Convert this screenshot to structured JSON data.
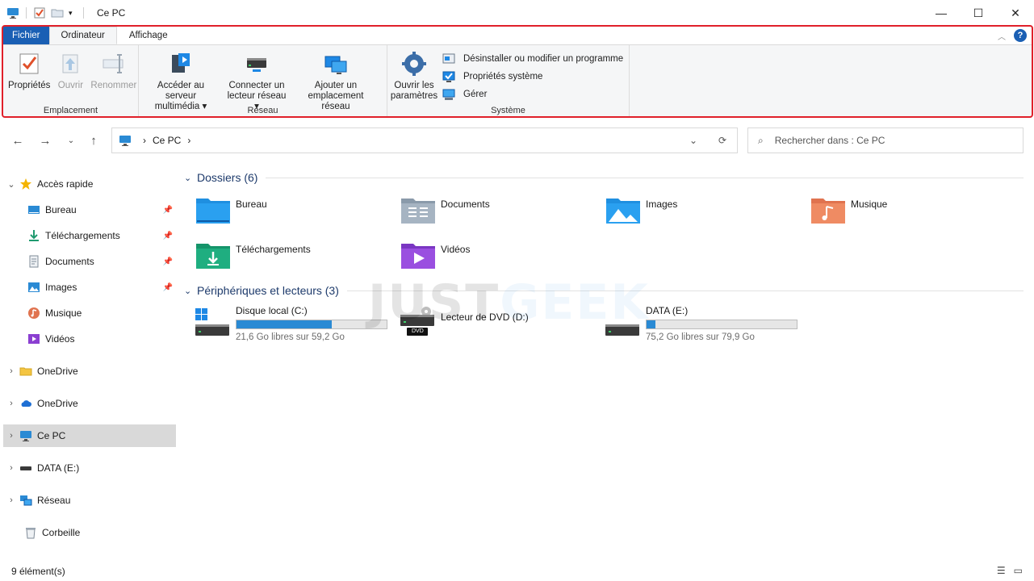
{
  "window": {
    "title": "Ce PC",
    "controls": {
      "minimize": "—",
      "maximize": "☐",
      "close": "✕"
    }
  },
  "ribbon": {
    "tabs": [
      {
        "label": "Fichier"
      },
      {
        "label": "Ordinateur"
      },
      {
        "label": "Affichage"
      }
    ],
    "groups": {
      "emplacement": {
        "label": "Emplacement",
        "buttons": {
          "proprietes": "Propriétés",
          "ouvrir": "Ouvrir",
          "renommer": "Renommer"
        }
      },
      "reseau": {
        "label": "Réseau",
        "buttons": {
          "acceder_l1": "Accéder au serveur",
          "acceder_l2": "multimédia",
          "connecter_l1": "Connecter un",
          "connecter_l2": "lecteur réseau",
          "ajouter_l1": "Ajouter un",
          "ajouter_l2": "emplacement réseau"
        }
      },
      "systeme": {
        "label": "Système",
        "buttons": {
          "ouvrir_l1": "Ouvrir les",
          "ouvrir_l2": "paramètres",
          "desinstaller": "Désinstaller ou modifier un programme",
          "proprietes_systeme": "Propriétés système",
          "gerer": "Gérer"
        }
      }
    },
    "help": "?"
  },
  "address": {
    "crumb": "Ce PC",
    "search_placeholder": "Rechercher dans : Ce PC"
  },
  "sidebar": {
    "quick_access": "Accès rapide",
    "pinned": [
      "Bureau",
      "Téléchargements",
      "Documents",
      "Images"
    ],
    "unpinned": [
      "Musique",
      "Vidéos"
    ],
    "roots": [
      "OneDrive",
      "OneDrive",
      "Ce PC",
      "DATA (E:)",
      "Réseau",
      "Corbeille"
    ]
  },
  "main": {
    "folders_header": "Dossiers (6)",
    "folders": [
      "Bureau",
      "Documents",
      "Images",
      "Musique",
      "Téléchargements",
      "Vidéos"
    ],
    "drives_header": "Périphériques et lecteurs (3)",
    "drives": [
      {
        "name": "Disque local (C:)",
        "free": "21,6 Go libres sur 59,2 Go",
        "used_fraction": 0.635
      },
      {
        "name": "Lecteur de DVD (D:)",
        "label": "DVD"
      },
      {
        "name": "DATA (E:)",
        "free": "75,2 Go libres sur 79,9 Go",
        "used_fraction": 0.059
      }
    ]
  },
  "watermark": {
    "part1": "JUST",
    "part2": "GEEK"
  },
  "status": {
    "count": "9 élément(s)"
  },
  "colors": {
    "accent": "#1a5fb4",
    "highlight": "#e0202a",
    "drive_fill": "#2a8ad4"
  }
}
